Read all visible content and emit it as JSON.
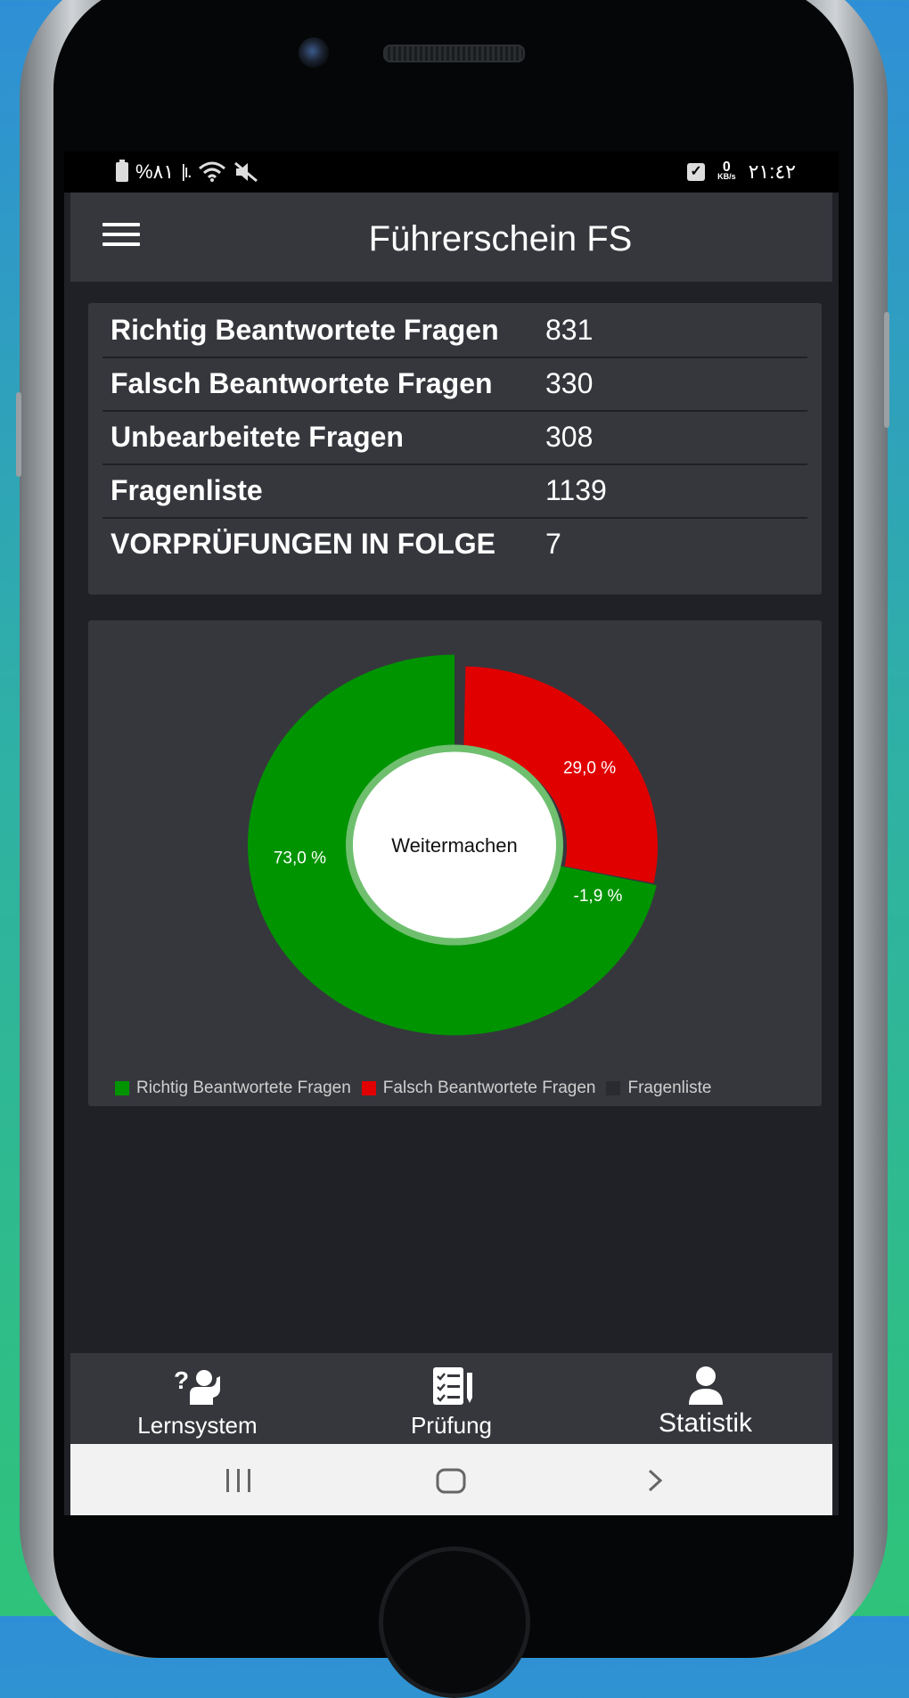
{
  "status_bar": {
    "battery_percent": "%۸۱",
    "time": "۲۱:٤۲",
    "net_speed_value": "0",
    "net_speed_unit": "KB/s",
    "icons": [
      "battery-icon",
      "signal-icon",
      "wifi-icon",
      "mute-icon",
      "checkbox-icon"
    ]
  },
  "app_bar": {
    "title": "Führerschein FS",
    "menu_icon": "hamburger-menu-icon"
  },
  "stats": [
    {
      "label": "Richtig Beantwortete Fragen",
      "value": "831"
    },
    {
      "label": "Falsch Beantwortete Fragen",
      "value": "330"
    },
    {
      "label": "Unbearbeitete Fragen",
      "value": "308"
    },
    {
      "label": "Fragenliste",
      "value": "1139"
    },
    {
      "label": "VORPRÜFUNGEN IN FOLGE",
      "value": "7"
    }
  ],
  "chart_data": {
    "type": "pie",
    "donut": true,
    "center_label": "Weitermachen",
    "categories": [
      "Richtig Beantwortete Fragen",
      "Falsch Beantwortete Fragen",
      "Fragenliste"
    ],
    "values": [
      73.0,
      29.0,
      -1.9
    ],
    "value_labels": [
      "73,0 %",
      "29,0 %",
      "-1,9 %"
    ],
    "colors": [
      "#009400",
      "#e00000",
      "#2a2b30"
    ],
    "legend_position": "bottom"
  },
  "bottom_nav": [
    {
      "label": "Lernsystem",
      "icon": "question-person-icon",
      "active": false
    },
    {
      "label": "Prüfung",
      "icon": "checklist-icon",
      "active": false
    },
    {
      "label": "Statistik",
      "icon": "person-icon",
      "active": true
    }
  ],
  "system_nav": {
    "icons": [
      "recent-apps-icon",
      "home-icon",
      "back-icon"
    ]
  }
}
